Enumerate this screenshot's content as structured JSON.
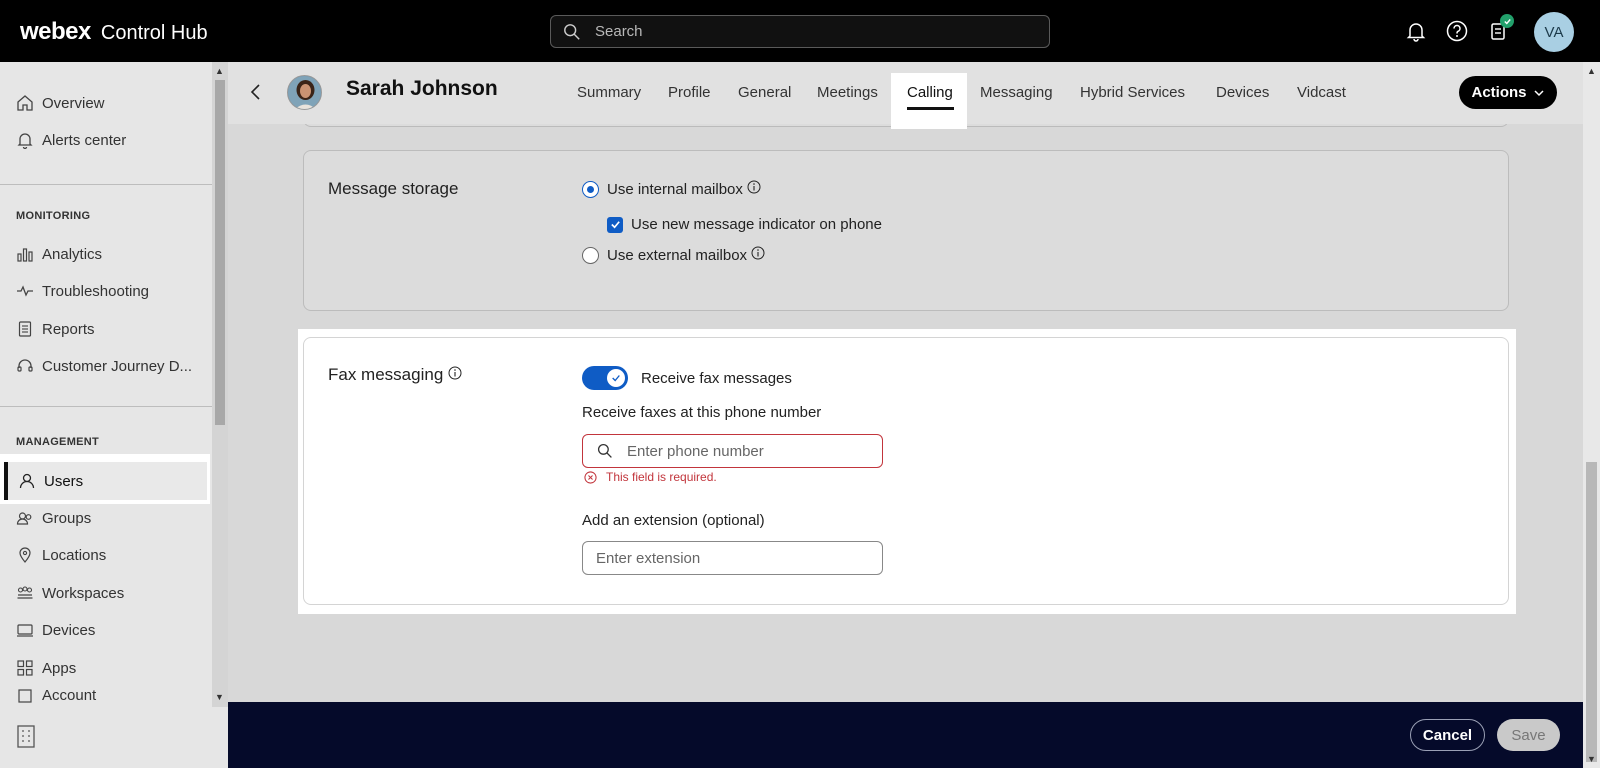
{
  "app": {
    "brand": "webex",
    "product": "Control Hub"
  },
  "search": {
    "placeholder": "Search"
  },
  "header_user": {
    "initials": "VA"
  },
  "sidebar": {
    "top_items": [
      {
        "label": "Overview",
        "icon": "home-icon"
      },
      {
        "label": "Alerts center",
        "icon": "bell-icon"
      }
    ],
    "monitoring": {
      "title": "MONITORING",
      "items": [
        {
          "label": "Analytics",
          "icon": "bar-chart-icon"
        },
        {
          "label": "Troubleshooting",
          "icon": "pulse-icon"
        },
        {
          "label": "Reports",
          "icon": "document-icon"
        },
        {
          "label": "Customer Journey D...",
          "icon": "headset-icon"
        }
      ]
    },
    "management": {
      "title": "MANAGEMENT",
      "items": [
        {
          "label": "Users",
          "icon": "user-icon",
          "active": true
        },
        {
          "label": "Groups",
          "icon": "group-icon"
        },
        {
          "label": "Locations",
          "icon": "location-pin-icon"
        },
        {
          "label": "Workspaces",
          "icon": "workspaces-icon"
        },
        {
          "label": "Devices",
          "icon": "device-icon"
        },
        {
          "label": "Apps",
          "icon": "apps-grid-icon"
        },
        {
          "label": "Account",
          "icon": "account-icon"
        }
      ]
    }
  },
  "profile": {
    "name": "Sarah Johnson"
  },
  "tabs": [
    "Summary",
    "Profile",
    "General",
    "Meetings",
    "Calling",
    "Messaging",
    "Hybrid Services",
    "Devices",
    "Vidcast"
  ],
  "active_tab": "Calling",
  "actions_label": "Actions",
  "message_storage": {
    "title": "Message storage",
    "internal": "Use internal mailbox",
    "indicator": "Use new message indicator on phone",
    "external": "Use external mailbox"
  },
  "fax": {
    "title": "Fax messaging",
    "toggle_label": "Receive fax messages",
    "phone_label": "Receive faxes at this phone number",
    "phone_placeholder": "Enter phone number",
    "error": "This field is required.",
    "ext_label": "Add an extension (optional)",
    "ext_placeholder": "Enter extension"
  },
  "footer": {
    "cancel": "Cancel",
    "save": "Save"
  },
  "colors": {
    "accent": "#0f5cc5",
    "error": "#c2353c",
    "footer": "#050a2a"
  }
}
